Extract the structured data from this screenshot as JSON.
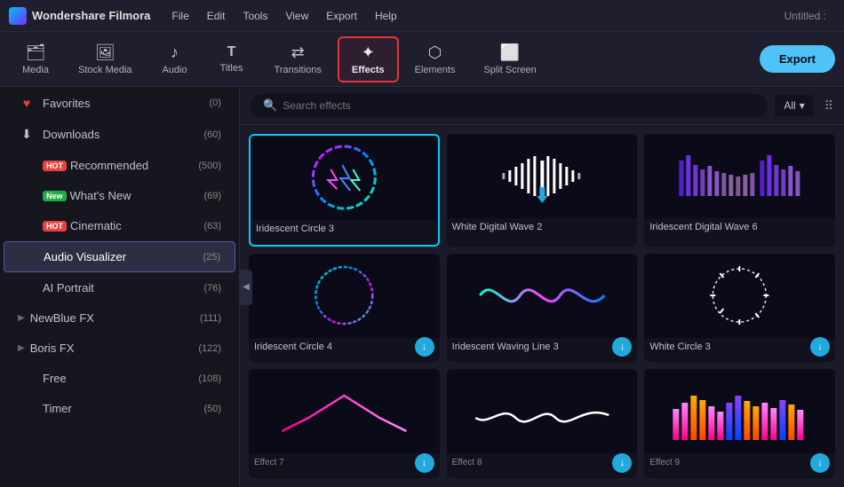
{
  "app": {
    "name": "Wondershare Filmora",
    "window_title": "Untitled :",
    "logo_alt": "filmora-logo"
  },
  "menu": {
    "items": [
      "File",
      "Edit",
      "Tools",
      "View",
      "Export",
      "Help"
    ]
  },
  "toolbar": {
    "items": [
      {
        "id": "media",
        "label": "Media",
        "icon": "🗂"
      },
      {
        "id": "stock-media",
        "label": "Stock Media",
        "icon": "🖼"
      },
      {
        "id": "audio",
        "label": "Audio",
        "icon": "♪"
      },
      {
        "id": "titles",
        "label": "Titles",
        "icon": "T"
      },
      {
        "id": "transitions",
        "label": "Transitions",
        "icon": "⇄"
      },
      {
        "id": "effects",
        "label": "Effects",
        "icon": "✦"
      },
      {
        "id": "elements",
        "label": "Elements",
        "icon": "⬡"
      },
      {
        "id": "split-screen",
        "label": "Split Screen",
        "icon": "⬜"
      }
    ],
    "active": "effects",
    "export_label": "Export"
  },
  "sidebar": {
    "items": [
      {
        "id": "favorites",
        "label": "Favorites",
        "icon": "♥",
        "count": "(0)",
        "badge": null
      },
      {
        "id": "downloads",
        "label": "Downloads",
        "icon": "⬇",
        "count": "(60)",
        "badge": null
      },
      {
        "id": "recommended",
        "label": "Recommended",
        "icon": "",
        "count": "(500)",
        "badge": "HOT"
      },
      {
        "id": "whats-new",
        "label": "What's New",
        "icon": "",
        "count": "(69)",
        "badge": "NEW"
      },
      {
        "id": "cinematic",
        "label": "Cinematic",
        "icon": "",
        "count": "(63)",
        "badge": "HOT"
      },
      {
        "id": "audio-visualizer",
        "label": "Audio Visualizer",
        "icon": "",
        "count": "(25)",
        "badge": null,
        "active": true
      },
      {
        "id": "ai-portrait",
        "label": "AI Portrait",
        "icon": "",
        "count": "(76)",
        "badge": null
      },
      {
        "id": "newblue-fx",
        "label": "NewBlue FX",
        "icon": "",
        "count": "(111)",
        "badge": null,
        "arrow": "▶"
      },
      {
        "id": "boris-fx",
        "label": "Boris FX",
        "icon": "",
        "count": "(122)",
        "badge": null,
        "arrow": "▶"
      },
      {
        "id": "free",
        "label": "Free",
        "icon": "",
        "count": "(108)",
        "badge": null
      },
      {
        "id": "timer",
        "label": "Timer",
        "icon": "",
        "count": "(50)",
        "badge": null
      }
    ]
  },
  "search": {
    "placeholder": "Search effects",
    "filter_label": "All",
    "filter_icon": "▾"
  },
  "effects": {
    "items": [
      {
        "id": "iridescent-circle-3",
        "name": "Iridescent Circle 3",
        "selected": true,
        "has_download": false,
        "type": "circle-iridescent"
      },
      {
        "id": "white-digital-wave-2",
        "name": "White  Digital Wave 2",
        "selected": false,
        "has_download": false,
        "type": "white-wave"
      },
      {
        "id": "iridescent-digital-wave-6",
        "name": "Iridescent Digital Wave 6",
        "selected": false,
        "has_download": false,
        "type": "iridescent-bars"
      },
      {
        "id": "iridescent-circle-4",
        "name": "Iridescent Circle 4",
        "selected": false,
        "has_download": true,
        "type": "circle-outline"
      },
      {
        "id": "iridescent-waving-line-3",
        "name": "Iridescent Waving Line 3",
        "selected": false,
        "has_download": true,
        "type": "waving-line"
      },
      {
        "id": "white-circle-3",
        "name": "White Circle 3",
        "selected": false,
        "has_download": true,
        "type": "white-circle"
      },
      {
        "id": "effect-7",
        "name": "Effect 7",
        "selected": false,
        "has_download": true,
        "type": "pink-wave"
      },
      {
        "id": "effect-8",
        "name": "Effect 8",
        "selected": false,
        "has_download": true,
        "type": "white-wave2"
      },
      {
        "id": "effect-9",
        "name": "Effect 9",
        "selected": false,
        "has_download": true,
        "type": "color-bars2"
      }
    ]
  }
}
